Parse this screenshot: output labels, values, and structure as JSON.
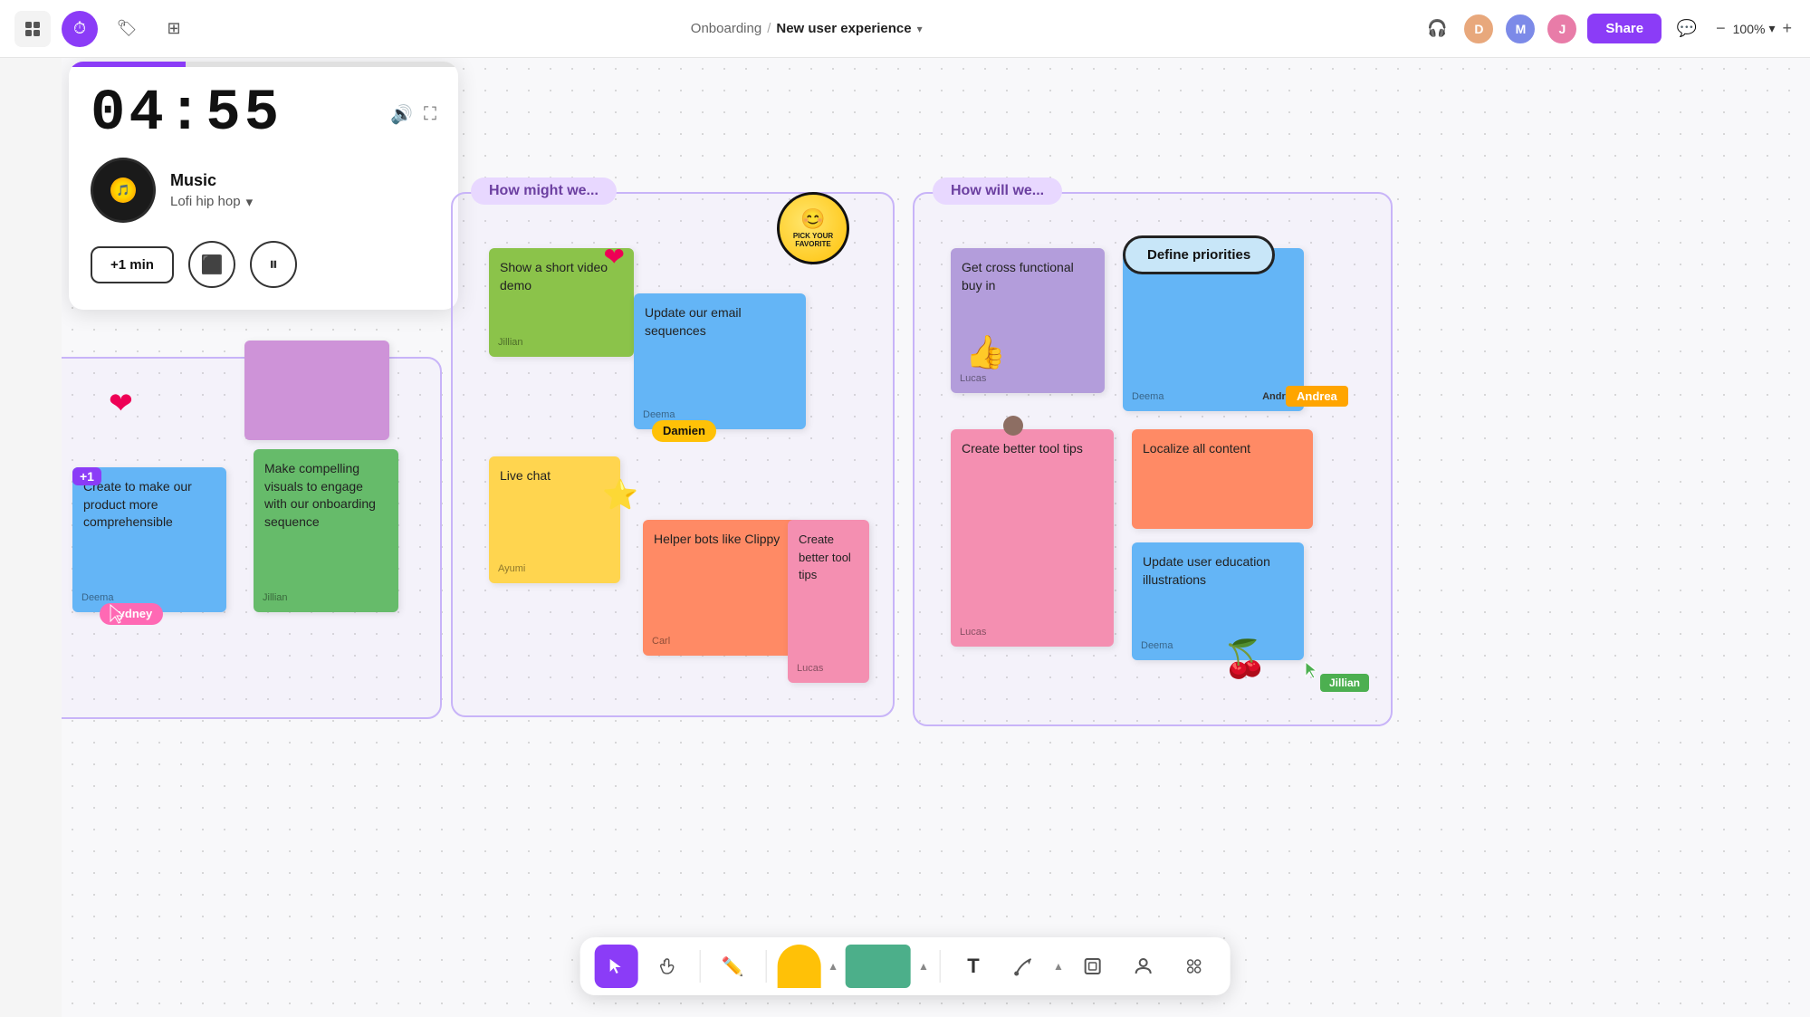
{
  "topbar": {
    "breadcrumb_parent": "Onboarding",
    "separator": "/",
    "page_name": "New user experience",
    "chevron": "▾",
    "share_label": "Share",
    "zoom_level": "100%",
    "zoom_minus": "−",
    "zoom_plus": "+"
  },
  "timer": {
    "time": "04:55",
    "music_label": "Music",
    "genre": "Lofi hip hop",
    "plus_min_label": "+1 min",
    "progress_percent": 30
  },
  "sections": {
    "left_label": "How might we...",
    "right_label": "How will we..."
  },
  "stickies": {
    "show_video": "Show a short video demo",
    "update_email": "Update our email sequences",
    "live_chat": "Live chat",
    "helper_bots": "Helper bots like Clippy",
    "create_comprehensible": "Create to make our product more comprehensible",
    "make_visuals": "Make compelling visuals to engage with our onboarding sequence",
    "get_cross": "Get cross functional buy in",
    "define_priorities": "Define priorities",
    "localize": "Localize all content",
    "update_illustrations": "Update user education illustrations",
    "create_tooltips": "Create better tool tips"
  },
  "authors": {
    "jillian": "Jillian",
    "deema": "Deema",
    "ayumi": "Ayumi",
    "carl": "Carl",
    "lucas": "Lucas"
  },
  "tags": {
    "damien": "Damien",
    "sydney": "Sydney",
    "andrea": "Andrea",
    "jillian": "Jillian"
  },
  "pick_favorite": "PICK YOUR\nFAVORITE",
  "toolbar": {
    "cursor_label": "▶",
    "hand_label": "✋",
    "text_label": "T",
    "shapes_label": "⬡",
    "frame_label": "⬜",
    "person_label": "👤",
    "group_label": "⚏"
  }
}
